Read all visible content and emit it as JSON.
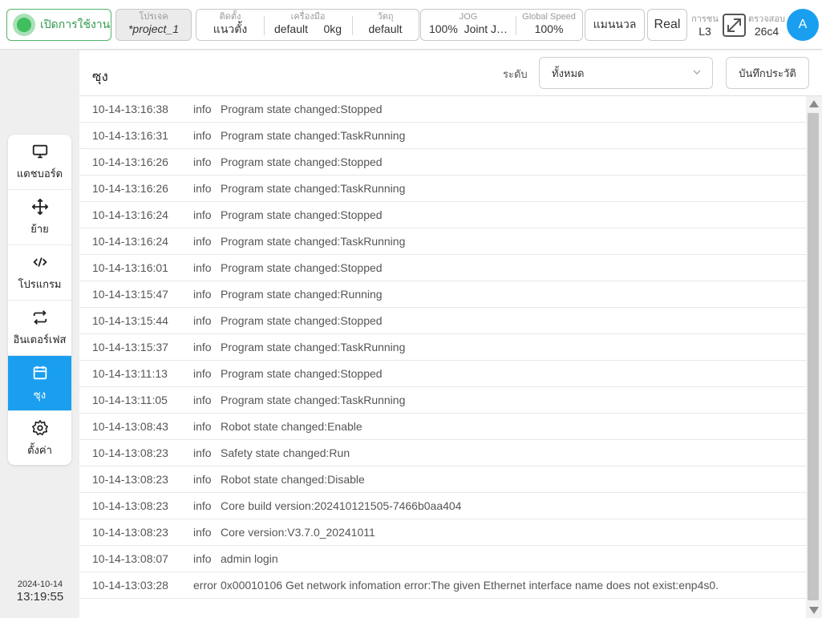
{
  "topbar": {
    "power_label": "เปิดการใช้งาน",
    "project": {
      "caption": "โปรเจค",
      "value": "*project_1"
    },
    "install": {
      "caption": "ติดตั้ง",
      "value": "แนวตั้ง"
    },
    "tool": {
      "caption": "เครื่องมือ",
      "value": "default",
      "payload": "0kg"
    },
    "workpiece": {
      "caption": "วัตถุ",
      "value": "default"
    },
    "jog": {
      "caption": "JOG",
      "speed": "100%",
      "mode": "Joint J…"
    },
    "global_speed": {
      "caption": "Global Speed",
      "value": "100%"
    },
    "manual_label": "แมนนวล",
    "real_label": "Real",
    "collision": {
      "caption": "การชน",
      "value": "L3"
    },
    "inspect": {
      "caption": "ตรวจสอบ",
      "value": "26c4"
    },
    "avatar_letter": "A"
  },
  "sidebar": {
    "items": [
      {
        "label": "แดชบอร์ด",
        "icon": "monitor-icon"
      },
      {
        "label": "ย้าย",
        "icon": "move-icon"
      },
      {
        "label": "โปรแกรม",
        "icon": "code-icon"
      },
      {
        "label": "อินเตอร์เฟส",
        "icon": "swap-icon"
      },
      {
        "label": "ซุง",
        "icon": "calendar-icon",
        "active": true
      },
      {
        "label": "ตั้งค่า",
        "icon": "gear-icon"
      }
    ],
    "date": "2024-10-14",
    "time": "13:19:55"
  },
  "panel": {
    "title": "ซุง",
    "level_label": "ระดับ",
    "level_value": "ทั้งหมด",
    "save_button": "บันทึกประวัติ"
  },
  "logs": [
    {
      "time": "10-14-13:16:38",
      "level": "info",
      "message": "Program state changed:Stopped"
    },
    {
      "time": "10-14-13:16:31",
      "level": "info",
      "message": "Program state changed:TaskRunning"
    },
    {
      "time": "10-14-13:16:26",
      "level": "info",
      "message": "Program state changed:Stopped"
    },
    {
      "time": "10-14-13:16:26",
      "level": "info",
      "message": "Program state changed:TaskRunning"
    },
    {
      "time": "10-14-13:16:24",
      "level": "info",
      "message": "Program state changed:Stopped"
    },
    {
      "time": "10-14-13:16:24",
      "level": "info",
      "message": "Program state changed:TaskRunning"
    },
    {
      "time": "10-14-13:16:01",
      "level": "info",
      "message": "Program state changed:Stopped"
    },
    {
      "time": "10-14-13:15:47",
      "level": "info",
      "message": "Program state changed:Running"
    },
    {
      "time": "10-14-13:15:44",
      "level": "info",
      "message": "Program state changed:Stopped"
    },
    {
      "time": "10-14-13:15:37",
      "level": "info",
      "message": "Program state changed:TaskRunning"
    },
    {
      "time": "10-14-13:11:13",
      "level": "info",
      "message": "Program state changed:Stopped"
    },
    {
      "time": "10-14-13:11:05",
      "level": "info",
      "message": "Program state changed:TaskRunning"
    },
    {
      "time": "10-14-13:08:43",
      "level": "info",
      "message": "Robot state changed:Enable"
    },
    {
      "time": "10-14-13:08:23",
      "level": "info",
      "message": "Safety state changed:Run"
    },
    {
      "time": "10-14-13:08:23",
      "level": "info",
      "message": "Robot state changed:Disable"
    },
    {
      "time": "10-14-13:08:23",
      "level": "info",
      "message": "Core build version:202410121505-7466b0aa404"
    },
    {
      "time": "10-14-13:08:23",
      "level": "info",
      "message": "Core version:V3.7.0_20241011"
    },
    {
      "time": "10-14-13:08:07",
      "level": "info",
      "message": "admin login"
    },
    {
      "time": "10-14-13:03:28",
      "level": "error",
      "message": "0x00010106 Get network infomation error:The given Ethernet interface name does not exist:enp4s0."
    }
  ],
  "colors": {
    "accent": "#1a9ff0",
    "power_green": "#2f9a4c"
  }
}
